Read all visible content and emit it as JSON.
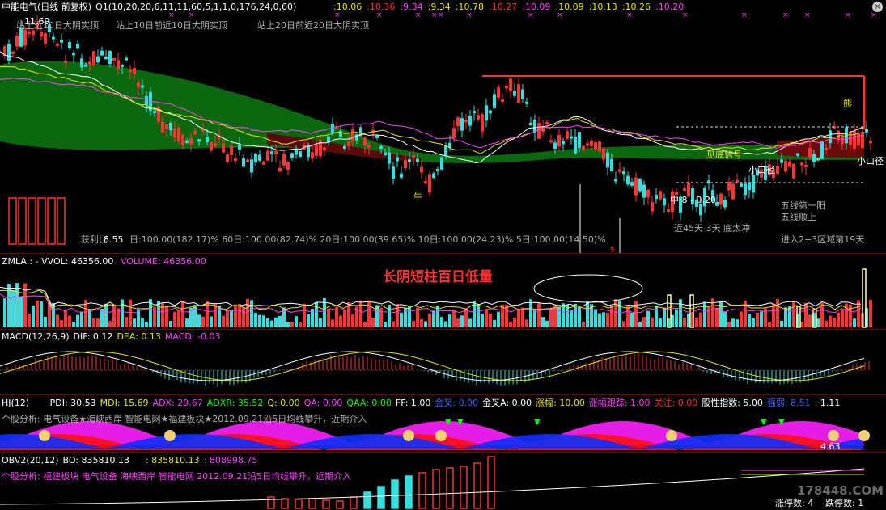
{
  "main": {
    "title": "中能电气(日线 前复权)",
    "indicator": "Q1(10,20,20,6,11,11,60,5,1,1,0,176,24,0,60)",
    "values": [
      "10.06",
      "10.36",
      "9.34",
      "9.34",
      "10.78",
      "10.27",
      "10.09",
      "10.09",
      "10.13",
      "10.26",
      "10.20"
    ],
    "value_colors": [
      "#e8e800",
      "#ff3030",
      "#ff40ff",
      "#e8e800",
      "#e8e800",
      "#ff3030",
      "#ff40ff",
      "#e8e800",
      "#e8e800",
      "#e8e800",
      "#ff40ff"
    ],
    "high_label": "11.69",
    "low_label": "8.55",
    "signals": [
      "站上近10日大阴实顶",
      "站上10日前近10日大阴实顶",
      "站上20日前近20日大阴实顶"
    ],
    "stats_label": "获利比",
    "stats": "日:100.00(182.17)%  60日:100.00(82.74)%  20日:100.00(39.65)%  10日:100.00(24.23)%  5日:100.00(14.50)%",
    "range_label": "中 8 - 9.20",
    "bottom_signal": "近45天 3天 底太冲",
    "ann_right_1": "五线第一阳",
    "ann_right_2": "五线顺上",
    "ann_right_3": "进入2+3区域第19天",
    "small_mouth_1": "小口径",
    "small_mouth_2": "小口径",
    "big_signal": "见底信号",
    "bear_char": "熊",
    "ox_char": "牛",
    "dollar_char": "$"
  },
  "volume": {
    "title": "ZMLA : - VVOL: 46356.00",
    "volume_label": "VOLUME: 46356.00",
    "annotation": "长阴短柱百日低量"
  },
  "macd": {
    "title": "MACD(12,26,9)",
    "dif": "DIF: 0.12",
    "dea": "DEA: 0.13",
    "macd": "MACD: -0.03"
  },
  "hj": {
    "title": "HJ(12)",
    "items": [
      {
        "text": "PDI: 30.53",
        "color": "#ffffff"
      },
      {
        "text": "MDI: 15.69",
        "color": "#e8e800"
      },
      {
        "text": "ADX: 29.67",
        "color": "#ff40ff"
      },
      {
        "text": "ADXR: 35.52",
        "color": "#00ff00"
      },
      {
        "text": "Q: 0.00",
        "color": "#e8e800"
      },
      {
        "text": "QA: 0.00",
        "color": "#ff40ff"
      },
      {
        "text": "QAA: 0.00",
        "color": "#00ff00"
      },
      {
        "text": "FF: 1.00",
        "color": "#ffffff"
      },
      {
        "text": "金叉: 0.00",
        "color": "#4060ff"
      },
      {
        "text": "金叉A: 0.00",
        "color": "#ffffff"
      },
      {
        "text": "涨幅: 10.00",
        "color": "#e8e800"
      },
      {
        "text": "涨幅跟踪: 1.00",
        "color": "#ff40ff"
      },
      {
        "text": "关注: 0.00",
        "color": "#ff3030"
      },
      {
        "text": "股性指数: 5.00",
        "color": "#ffffff"
      },
      {
        "text": "强弱: 8.51",
        "color": "#4060ff"
      },
      {
        "text": ": 1.11",
        "color": "#ffffff"
      }
    ],
    "analysis": "个股分析: 电气设备★海峡西岸 智能电网★福建板块★2012.09.21沿5日均线攀升，近期介入",
    "value_label": "4.63"
  },
  "obv": {
    "title": "OBV2(20,12)",
    "bo": "BO: 835810.13",
    "v1": ": 835810.13",
    "v2": ": 808998.75",
    "analysis": "个股分析: 福建板块 电气设备 海峡西岸 智能电网  2012.09.21沿5日均线攀升，近期介入",
    "limit_up": "涨停数: 4",
    "limit_down": "跌停数: 1",
    "watermark": "178448.COM"
  }
}
